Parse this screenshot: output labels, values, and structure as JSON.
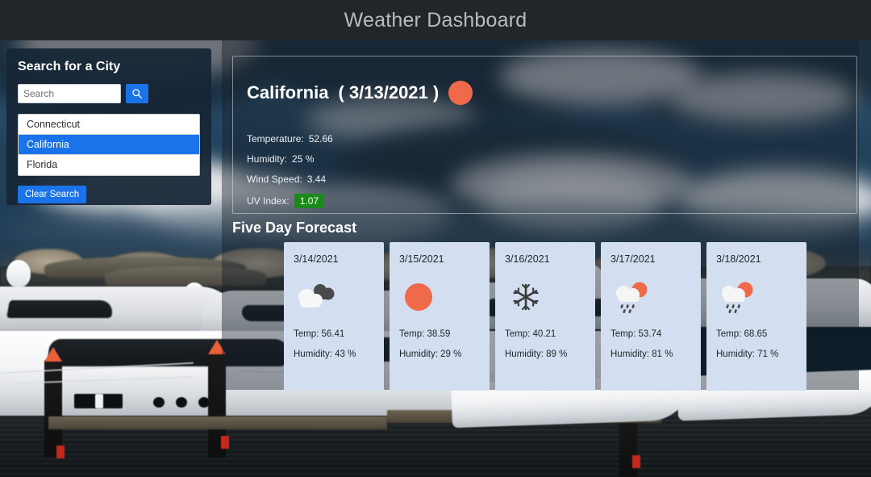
{
  "header": {
    "title": "Weather Dashboard"
  },
  "sidebar": {
    "heading": "Search for a City",
    "search": {
      "placeholder": "Search",
      "value": ""
    },
    "search_button_icon": "search-icon",
    "cities": [
      {
        "name": "Connecticut",
        "selected": false
      },
      {
        "name": "California",
        "selected": true
      },
      {
        "name": "Florida",
        "selected": false
      }
    ],
    "clear_button_label": "Clear Search"
  },
  "today": {
    "city": "California",
    "date": "( 3/13/2021 )",
    "icon": "sun-icon",
    "stats": [
      {
        "label": "Temperature:",
        "value": "52.66"
      },
      {
        "label": "Humidity:",
        "value": "25 %"
      },
      {
        "label": "Wind Speed:",
        "value": "3.44"
      }
    ],
    "uv_label": "UV Index:",
    "uv_value": "1.07",
    "uv_color": "#1a8a1a"
  },
  "forecast": {
    "title": "Five Day Forecast",
    "cards": [
      {
        "date": "3/14/2021",
        "icon": "broken-clouds-icon",
        "temp_label": "Temp:",
        "temp": "56.41",
        "humidity_label": "Humidity:",
        "humidity": "43 %"
      },
      {
        "date": "3/15/2021",
        "icon": "sun-icon",
        "temp_label": "Temp:",
        "temp": "38.59",
        "humidity_label": "Humidity:",
        "humidity": "29 %"
      },
      {
        "date": "3/16/2021",
        "icon": "snowflake-icon",
        "temp_label": "Temp:",
        "temp": "40.21",
        "humidity_label": "Humidity:",
        "humidity": "89 %"
      },
      {
        "date": "3/17/2021",
        "icon": "sun-rain-cloud-icon",
        "temp_label": "Temp:",
        "temp": "53.74",
        "humidity_label": "Humidity:",
        "humidity": "81 %"
      },
      {
        "date": "3/18/2021",
        "icon": "sun-rain-cloud-icon",
        "temp_label": "Temp:",
        "temp": "68.65",
        "humidity_label": "Humidity:",
        "humidity": "71 %"
      }
    ]
  },
  "colors": {
    "header_bg": "#222529",
    "accent_blue": "#1a73e8",
    "sun_orange": "#ef6a4a",
    "uv_green": "#1a8a1a",
    "forecast_card_bg": "#d3dff0"
  },
  "background": {
    "scene": "marina-with-yachts-and-cloudy-sky"
  }
}
